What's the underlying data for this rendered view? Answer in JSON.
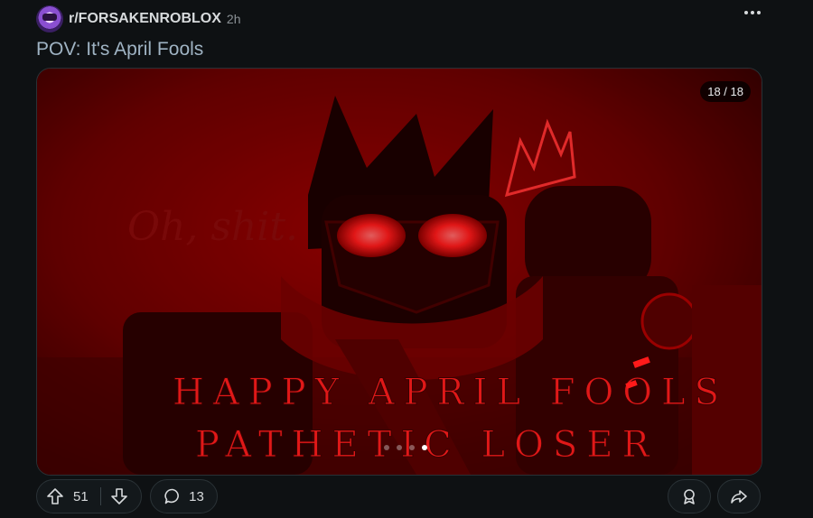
{
  "post": {
    "subreddit": "r/FORSAKENROBLOX",
    "age": "2h",
    "title": "POV: It's April Fools"
  },
  "media": {
    "counter": "18 / 18",
    "dots_total": 4,
    "dots_active_index": 3,
    "overlay_text_line1": "HAPPY APRIL FOOLS",
    "overlay_text_line2": "PATHETIC LOSER",
    "caption_script": "Oh, shit."
  },
  "actions": {
    "upvotes": "51",
    "comments": "13"
  },
  "colors": {
    "background": "#0e1113",
    "image_red": "#8b0000",
    "text": "#d7dadc",
    "title": "#9fb3c3"
  },
  "icons": [
    "more-options-icon",
    "upvote-icon",
    "downvote-icon",
    "comment-icon",
    "award-icon",
    "share-icon"
  ]
}
